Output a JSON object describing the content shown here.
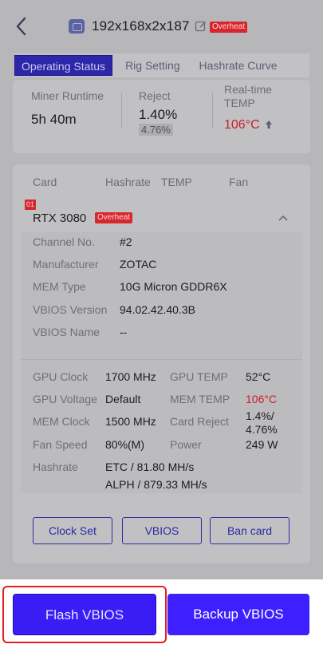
{
  "header": {
    "title": "192x168x2x187",
    "status_badge": "Overheat"
  },
  "tabs": [
    "Operating Status",
    "Rig Setting",
    "Hashrate Curve"
  ],
  "summary": {
    "runtime_label": "Miner Runtime",
    "runtime_value": "5h 40m",
    "reject_label": "Reject",
    "reject_value": "1.40%",
    "reject_sub": "4.76%",
    "temp_label_1": "Real-time",
    "temp_label_2": "TEMP",
    "temp_value": "106°C"
  },
  "card_table": {
    "columns": [
      "Card",
      "Hashrate",
      "TEMP",
      "Fan"
    ],
    "index": "01",
    "gpu_name": "RTX 3080",
    "gpu_badge": "Overheat",
    "info": [
      {
        "k": "Channel No.",
        "v": "#2"
      },
      {
        "k": "Manufacturer",
        "v": "ZOTAC"
      },
      {
        "k": "MEM Type",
        "v": "10G Micron GDDR6X"
      },
      {
        "k": "VBIOS Version",
        "v": "94.02.42.40.3B"
      },
      {
        "k": "VBIOS Name",
        "v": "--"
      }
    ],
    "stats": {
      "gpu_clock_k": "GPU Clock",
      "gpu_clock_v": "1700 MHz",
      "gpu_temp_k": "GPU TEMP",
      "gpu_temp_v": "52°C",
      "gpu_voltage_k": "GPU Voltage",
      "gpu_voltage_v": "Default",
      "mem_temp_k": "MEM TEMP",
      "mem_temp_v": "106°C",
      "mem_clock_k": "MEM Clock",
      "mem_clock_v": "1500 MHz",
      "card_reject_k": "Card Reject",
      "card_reject_v1": "1.4%/",
      "card_reject_v2": "4.76%",
      "fan_speed_k": "Fan Speed",
      "fan_speed_v": "80%(M)",
      "power_k": "Power",
      "power_v": "249 W",
      "hashrate_k": "Hashrate",
      "hashrate_v1": "ETC / 81.80 MH/s",
      "hashrate_v2": "ALPH / 879.33 MH/s"
    },
    "buttons": [
      "Clock Set",
      "VBIOS",
      "Ban card"
    ]
  },
  "bottom_bar": {
    "flash_label": "Flash VBIOS",
    "backup_label": "Backup VBIOS"
  },
  "colors": {
    "accent": "#3d1fff",
    "danger": "#d8262d"
  }
}
